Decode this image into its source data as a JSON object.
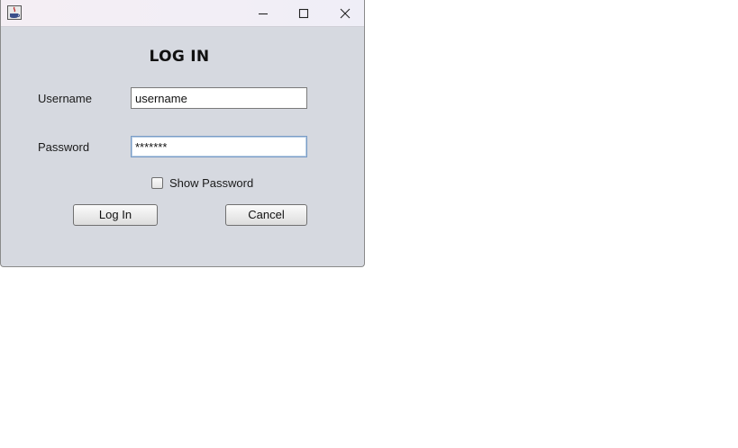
{
  "window": {
    "controls": {
      "minimize": "minimize-icon",
      "maximize": "maximize-icon",
      "close": "close-icon"
    },
    "app_icon": "java-app-icon"
  },
  "form": {
    "title": "LOG IN",
    "username_label": "Username",
    "username_value": "username",
    "password_label": "Password",
    "password_value": "*******",
    "show_password_label": "Show Password",
    "show_password_checked": false,
    "login_button": "Log In",
    "cancel_button": "Cancel"
  }
}
